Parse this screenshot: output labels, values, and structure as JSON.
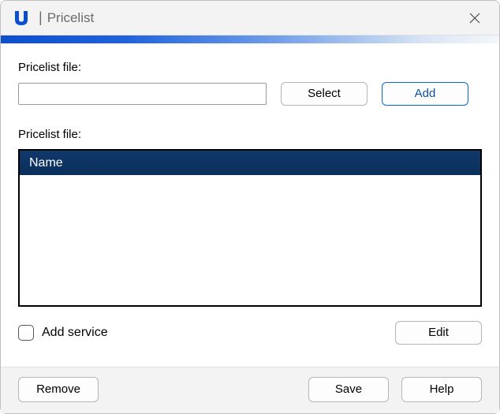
{
  "window": {
    "title": "Pricelist",
    "logo_letter": "U",
    "separator": "|"
  },
  "labels": {
    "pricelist_file_1": "Pricelist file:",
    "pricelist_file_2": "Pricelist file:",
    "add_service": "Add service"
  },
  "inputs": {
    "pricelist_path": ""
  },
  "buttons": {
    "select": "Select",
    "add": "Add",
    "edit": "Edit",
    "remove": "Remove",
    "save": "Save",
    "help": "Help"
  },
  "table": {
    "header": "Name",
    "rows": []
  },
  "checkboxes": {
    "add_service": false
  }
}
